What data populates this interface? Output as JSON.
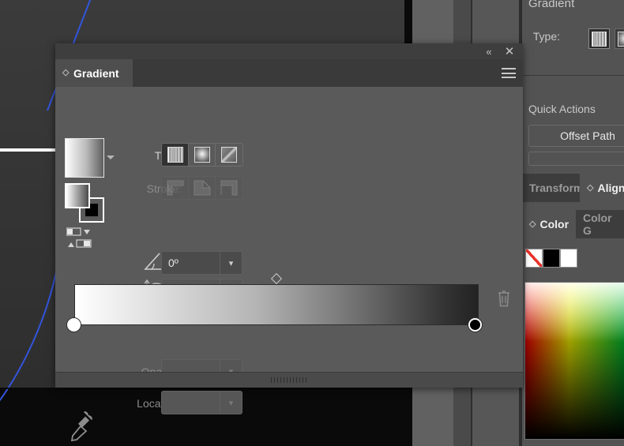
{
  "app": {
    "theme_bg": "#0a0a0a",
    "panel_bg": "#5a5a5a",
    "accent": "#e8342a"
  },
  "floating_panel": {
    "titlebar": {
      "collapse_label": "«",
      "collapse_icon": "double-chevron-left-icon",
      "close_label": "✕",
      "close_icon": "close-icon"
    },
    "tab": {
      "label": "Gradient",
      "grip_icon": "updown-chevron-icon",
      "menu_icon": "hamburger-menu-icon"
    },
    "preview": {
      "name": "gradient-preview-swatch",
      "caret_icon": "caret-down-icon"
    },
    "proxy": {
      "fill_name": "fill-proxy-swatch",
      "stroke_name": "stroke-proxy-swatch",
      "reverse_icon": "reverse-gradient-icon"
    },
    "type_row": {
      "label": "Type:",
      "options": [
        {
          "name": "linear-gradient-button",
          "icon": "linear-gradient-icon",
          "selected": true
        },
        {
          "name": "radial-gradient-button",
          "icon": "radial-gradient-icon",
          "selected": false
        },
        {
          "name": "freeform-gradient-button",
          "icon": "freeform-gradient-icon",
          "selected": false
        }
      ]
    },
    "stroke_row": {
      "label": "Stroke:",
      "disabled": true,
      "options": [
        {
          "name": "stroke-within-button",
          "icon": "stroke-within-icon"
        },
        {
          "name": "stroke-along-button",
          "icon": "stroke-along-icon"
        },
        {
          "name": "stroke-across-button",
          "icon": "stroke-across-icon"
        }
      ]
    },
    "angle_row": {
      "icon": "angle-icon",
      "value": "0º",
      "dropdown_icon": "chevron-down-icon",
      "disabled": false
    },
    "aspect_row": {
      "icon": "aspect-ratio-icon",
      "value": "",
      "dropdown_icon": "chevron-down-icon",
      "disabled": true
    },
    "slider": {
      "name": "gradient-slider",
      "midpoint_icon": "midpoint-diamond-icon",
      "stops": [
        {
          "name": "gradient-stop-white",
          "color": "#ffffff",
          "location": 0
        },
        {
          "name": "gradient-stop-black",
          "color": "#000000",
          "location": 100
        }
      ],
      "delete_icon": "trash-icon"
    },
    "opacity_row": {
      "label": "Opacity:",
      "value": "",
      "dropdown_icon": "chevron-down-icon",
      "disabled": true
    },
    "location_row": {
      "label": "Location:",
      "value": "",
      "dropdown_icon": "chevron-down-icon",
      "disabled": true
    },
    "eyedropper_icon": "eyedropper-icon",
    "resize_grip": "resize-grip"
  },
  "dock": {
    "gradient_panel": {
      "title": "Gradient",
      "type_label": "Type:",
      "options": [
        {
          "name": "dock-linear-gradient-button",
          "icon": "linear-gradient-icon",
          "selected": true
        },
        {
          "name": "dock-radial-gradient-button",
          "icon": "radial-gradient-icon",
          "selected": false
        }
      ]
    },
    "quick_actions": {
      "title": "Quick Actions",
      "buttons": [
        {
          "label": "Offset Path",
          "name": "offset-path-button"
        }
      ]
    },
    "transform_align_tabs": [
      {
        "label": "Transform",
        "name": "tab-transform",
        "active": false
      },
      {
        "label": "Align",
        "name": "tab-align",
        "active": true
      }
    ],
    "color_tabs": [
      {
        "label": "Color",
        "name": "tab-color",
        "active": true
      },
      {
        "label": "Color G",
        "name": "tab-color-guide",
        "active": false
      }
    ],
    "color_swatches": [
      {
        "name": "swatch-none",
        "label": "None",
        "color": "none"
      },
      {
        "name": "swatch-black",
        "label": "Black",
        "color": "#000000"
      },
      {
        "name": "swatch-white",
        "label": "White",
        "color": "#ffffff"
      }
    ],
    "spectrum": {
      "name": "color-spectrum-field"
    }
  },
  "canvas": {
    "name": "artboard-canvas",
    "path_color": "#3355dd",
    "guide_color": "#ffffff"
  }
}
